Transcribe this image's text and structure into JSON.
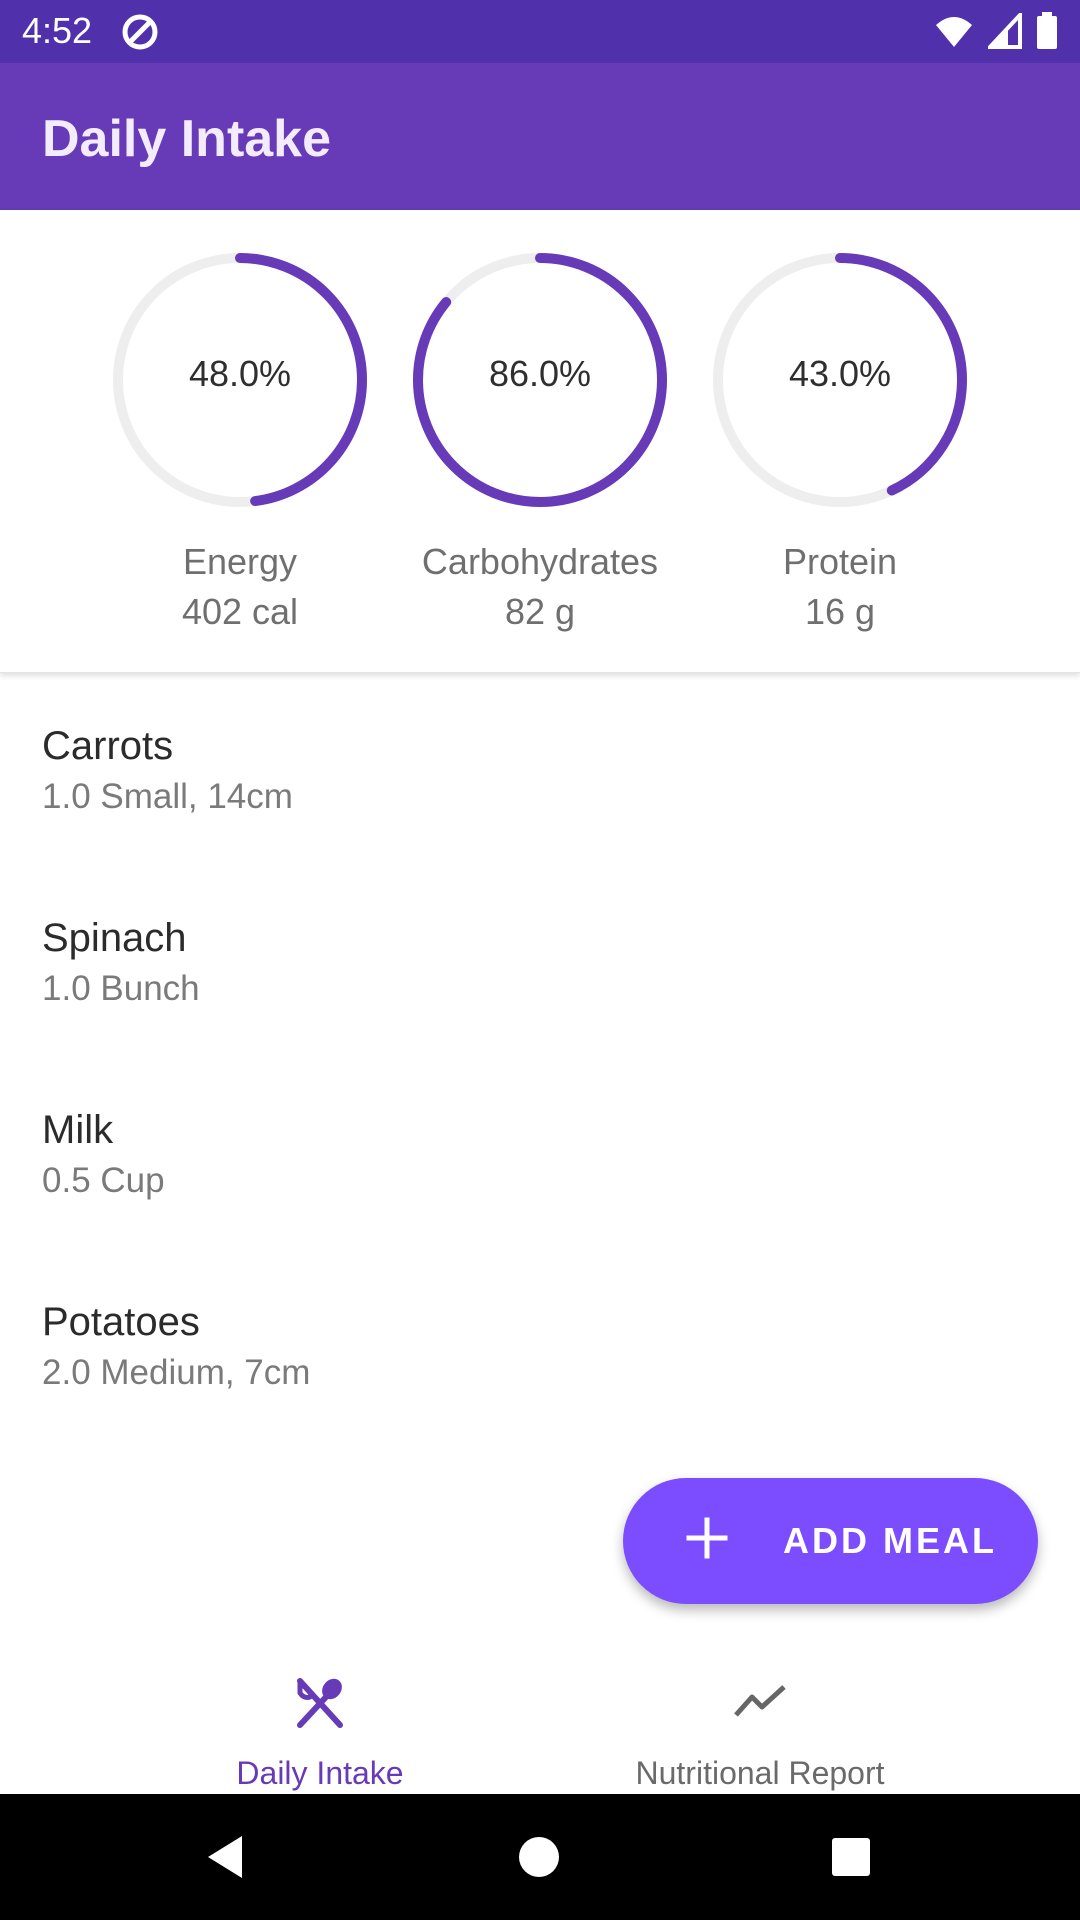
{
  "status_bar": {
    "time": "4:52",
    "icons": [
      "app-notification-icon",
      "wifi-icon",
      "signal-icon",
      "battery-icon"
    ]
  },
  "app_bar": {
    "title": "Daily Intake"
  },
  "summary": {
    "gauges": [
      {
        "percent_text": "48.0%",
        "progress": 0.48,
        "label": "Energy",
        "value": "402 cal"
      },
      {
        "percent_text": "86.0%",
        "progress": 0.86,
        "label": "Carbohydrates",
        "value": "82 g"
      },
      {
        "percent_text": "43.0%",
        "progress": 0.43,
        "label": "Protein",
        "value": "16 g"
      }
    ]
  },
  "meals": [
    {
      "name": "Carrots",
      "quantity": "1.0 Small, 14cm"
    },
    {
      "name": "Spinach",
      "quantity": "1.0 Bunch"
    },
    {
      "name": "Milk",
      "quantity": "0.5 Cup"
    },
    {
      "name": "Potatoes",
      "quantity": "2.0 Medium, 7cm"
    }
  ],
  "fab": {
    "label": "ADD MEAL",
    "icon": "plus-icon"
  },
  "bottom_nav": {
    "items": [
      {
        "label": "Daily Intake",
        "icon": "utensils-icon",
        "active": true
      },
      {
        "label": "Nutritional Report",
        "icon": "trending-icon",
        "active": false
      }
    ]
  },
  "system_nav": {
    "icons": [
      "back-icon",
      "home-icon",
      "recents-icon"
    ]
  },
  "colors": {
    "status_bar": "#5130AC",
    "app_bar": "#673AB7",
    "accent": "#673AB7",
    "fab": "#7C4DFF",
    "gauge_track": "#EEEEEE"
  }
}
